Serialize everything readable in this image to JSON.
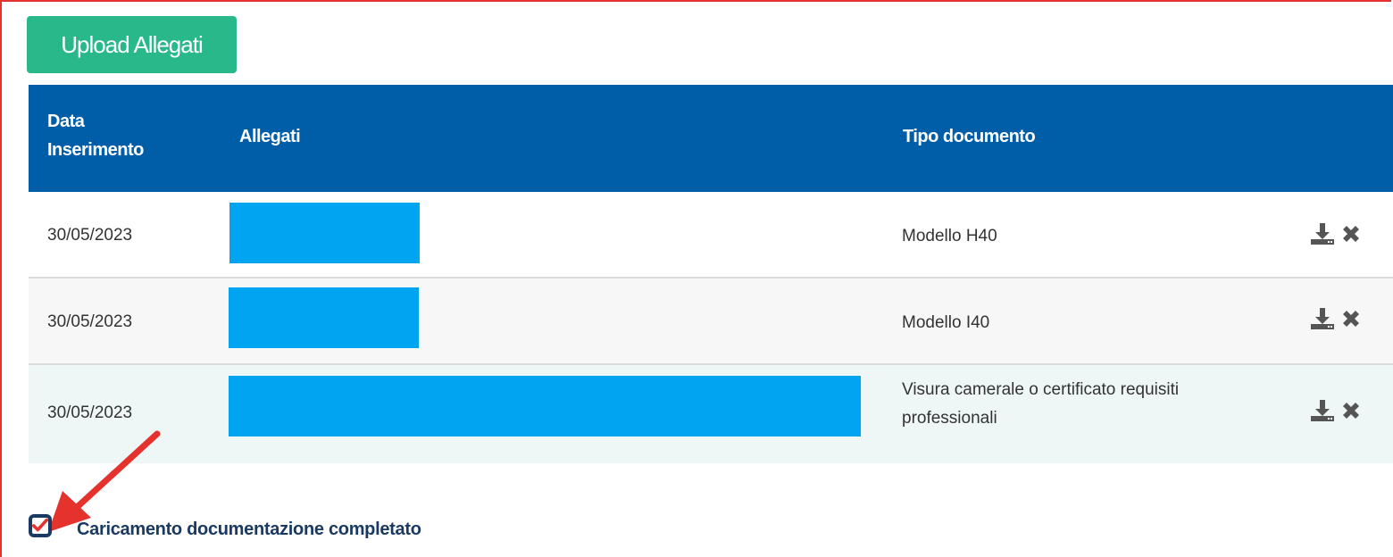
{
  "upload_button": {
    "label": "Upload Allegati"
  },
  "table": {
    "headers": {
      "data_line1": "Data",
      "data_line2": "Inserimento",
      "allegati": "Allegati",
      "tipo": "Tipo documento"
    },
    "rows": [
      {
        "date": "30/05/2023",
        "tipo_line1": "Modello H40",
        "tipo_line2": ""
      },
      {
        "date": "30/05/2023",
        "tipo_line1": "Modello I40",
        "tipo_line2": ""
      },
      {
        "date": "30/05/2023",
        "tipo_line1": "Visura camerale o certificato requisiti",
        "tipo_line2": "professionali"
      }
    ]
  },
  "checkbox": {
    "label": "Caricamento documentazione completato",
    "checked": true
  },
  "colors": {
    "header_bg": "#005ea8",
    "button_bg": "#28b88a",
    "redaction": "#00a4f1",
    "frame": "#e5322d",
    "check": "#e5322d"
  },
  "icons": [
    "download-icon",
    "delete-icon",
    "check-icon",
    "annotation-arrow"
  ]
}
